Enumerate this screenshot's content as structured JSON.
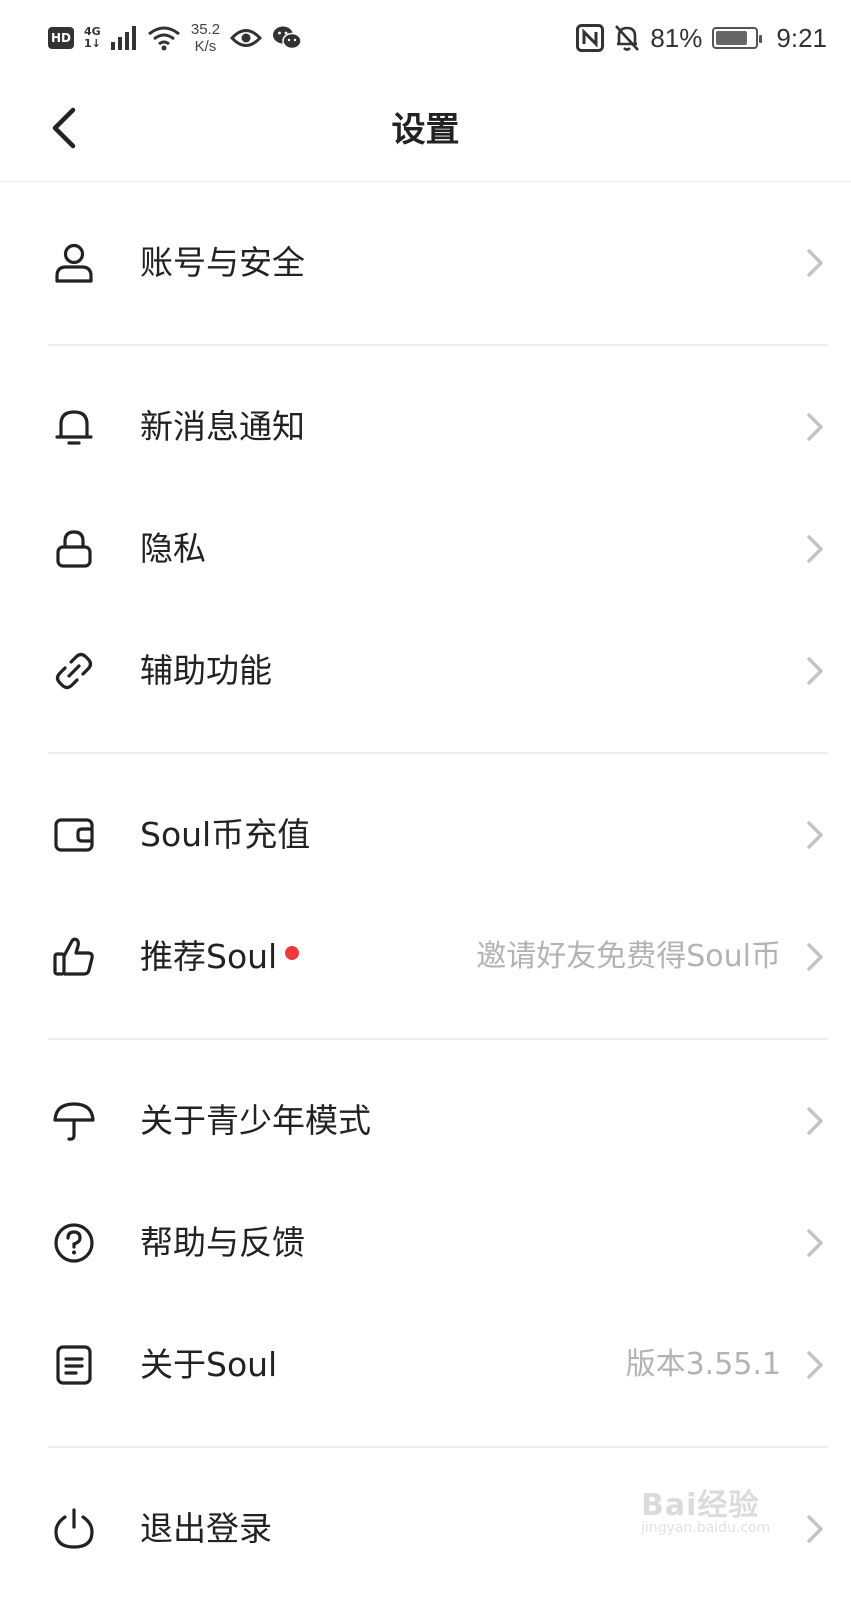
{
  "status_bar": {
    "hd": "HD",
    "net_top": "4G",
    "net_bottom": "1↓",
    "speed_value": "35.2",
    "speed_unit": "K/s",
    "battery_percent": "81%",
    "battery_level": 0.81,
    "time": "9:21"
  },
  "header": {
    "title": "设置"
  },
  "sections": [
    {
      "items": [
        {
          "label": "账号与安全",
          "sub": ""
        }
      ]
    },
    {
      "items": [
        {
          "label": "新消息通知",
          "sub": ""
        },
        {
          "label": "隐私",
          "sub": ""
        },
        {
          "label": "辅助功能",
          "sub": ""
        }
      ]
    },
    {
      "items": [
        {
          "label": "Soul币充值",
          "sub": ""
        },
        {
          "label": "推荐Soul",
          "sub": "邀请好友免费得Soul币"
        }
      ]
    },
    {
      "items": [
        {
          "label": "关于青少年模式",
          "sub": ""
        },
        {
          "label": "帮助与反馈",
          "sub": ""
        },
        {
          "label": "关于Soul",
          "sub": "版本3.55.1"
        }
      ]
    },
    {
      "items": [
        {
          "label": "退出登录",
          "sub": ""
        }
      ]
    }
  ],
  "icons": {
    "account": "user-icon",
    "notify": "bell-icon",
    "privacy": "lock-icon",
    "assist": "link-icon",
    "coin": "wallet-icon",
    "recommend": "thumbs-up-icon",
    "teen": "umbrella-icon",
    "help": "question-circle-icon",
    "about": "document-icon",
    "logout": "power-icon"
  },
  "colors": {
    "text": "#222222",
    "sub_text": "#b3b3b3",
    "divider": "#ececec",
    "dot": "#ee3b3b"
  },
  "watermark": {
    "text": "Bai经验",
    "sub": "jingyan.baidu.com"
  }
}
